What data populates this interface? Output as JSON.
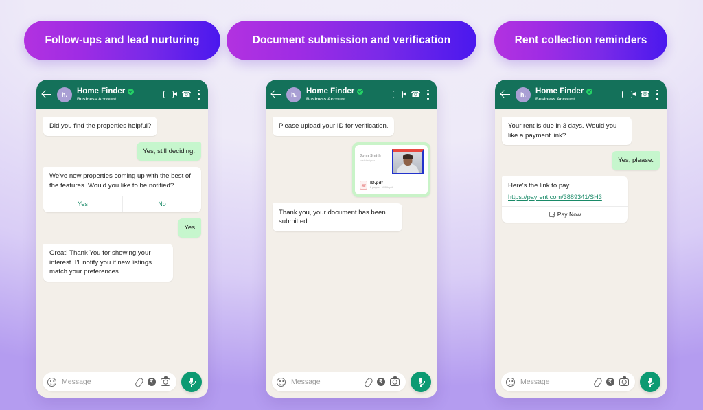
{
  "theme": {
    "pill_gradient_from": "#b232e0",
    "pill_gradient_to": "#4a18ee",
    "whatsapp_header": "#14715a",
    "outgoing_bubble": "#c6f6cd",
    "incoming_bubble": "#ffffff",
    "chat_background": "#f3efe9",
    "accent_green": "#1a8a68",
    "mic_button": "#0c9a72",
    "page_background_top": "#f0edf9",
    "page_background_bottom": "#b49cf0"
  },
  "columns": [
    {
      "pill_label": "Follow-ups and lead nurturing",
      "header": {
        "back_icon": "back-arrow-icon",
        "avatar_initials": "h.",
        "name": "Home Finder",
        "verified_icon": "verified-badge-icon",
        "subtitle": "Business Account",
        "video_icon": "video-call-icon",
        "phone_icon": "phone-call-icon",
        "menu_icon": "more-options-icon"
      },
      "messages": [
        {
          "type": "in",
          "text": "Did you find the properties helpful?"
        },
        {
          "type": "out",
          "text": "Yes, still deciding."
        },
        {
          "type": "in-buttons",
          "text": "We've new properties coming up with the best of the features. Would you like to be notified?",
          "buttons": [
            "Yes",
            "No"
          ]
        },
        {
          "type": "out",
          "text": "Yes"
        },
        {
          "type": "in",
          "text": "Great! Thank You for showing your interest.  I'll notify you if new listings match your preferences."
        }
      ],
      "input": {
        "emoji_icon": "emoji-smiley-icon",
        "placeholder": "Message",
        "attach_icon": "paperclip-icon",
        "payment_icon": "rupee-payment-icon",
        "camera_icon": "camera-icon",
        "mic_icon": "microphone-icon"
      }
    },
    {
      "pill_label": "Document submission and verification",
      "header": {
        "back_icon": "back-arrow-icon",
        "avatar_initials": "h.",
        "name": "Home Finder",
        "verified_icon": "verified-badge-icon",
        "subtitle": "Business Account",
        "video_icon": "video-call-icon",
        "phone_icon": "phone-call-icon",
        "menu_icon": "more-options-icon"
      },
      "messages": [
        {
          "type": "in",
          "text": "Please upload your ID for verification."
        },
        {
          "type": "out-document",
          "card_name": "John Smith",
          "card_role": "road designer",
          "file_name": "ID.pdf",
          "file_meta": "2 pages · 100kb pdf",
          "photo_icon": "id-portrait-photo",
          "pdf_icon": "pdf-file-icon"
        },
        {
          "type": "in",
          "text": "Thank you, your document has been submitted."
        }
      ],
      "input": {
        "emoji_icon": "emoji-smiley-icon",
        "placeholder": "Message",
        "attach_icon": "paperclip-icon",
        "payment_icon": "rupee-payment-icon",
        "camera_icon": "camera-icon",
        "mic_icon": "microphone-icon"
      }
    },
    {
      "pill_label": "Rent collection reminders",
      "header": {
        "back_icon": "back-arrow-icon",
        "avatar_initials": "h.",
        "name": "Home Finder",
        "verified_icon": "verified-badge-icon",
        "subtitle": "Business Account",
        "video_icon": "video-call-icon",
        "phone_icon": "phone-call-icon",
        "menu_icon": "more-options-icon"
      },
      "messages": [
        {
          "type": "in",
          "text": "Your rent is due in 3 days. Would you like a payment link?"
        },
        {
          "type": "out",
          "text": "Yes, please."
        },
        {
          "type": "in-payment",
          "text": "Here's the link to pay.",
          "link": "https://payrent.com/3889341/SH3",
          "button_label": "Pay Now",
          "button_icon": "external-link-icon"
        }
      ],
      "input": {
        "emoji_icon": "emoji-smiley-icon",
        "placeholder": "Message",
        "attach_icon": "paperclip-icon",
        "payment_icon": "rupee-payment-icon",
        "camera_icon": "camera-icon",
        "mic_icon": "microphone-icon"
      }
    }
  ]
}
